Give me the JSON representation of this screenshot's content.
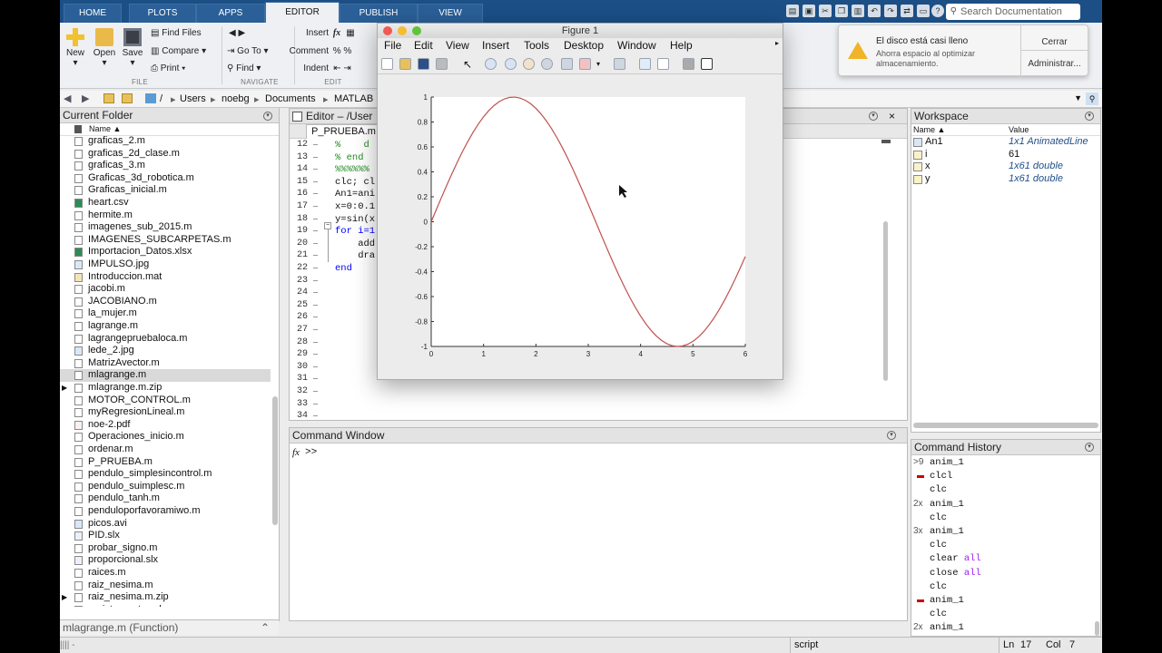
{
  "tabs": [
    "HOME",
    "PLOTS",
    "APPS",
    "EDITOR",
    "PUBLISH",
    "VIEW"
  ],
  "active_tab": "EDITOR",
  "search": {
    "placeholder": "Search Documentation"
  },
  "ribbon": {
    "new": "New",
    "open": "Open",
    "save": "Save",
    "find_files": "Find Files",
    "compare": "Compare",
    "print": "Print",
    "insert": "Insert",
    "fx": "fx",
    "comment": "Comment",
    "indent": "Indent",
    "go_to": "Go To",
    "find": "Find",
    "sec_file": "FILE",
    "sec_navigate": "NAVIGATE",
    "sec_edit": "EDIT"
  },
  "address": {
    "sep": "/",
    "parts": [
      "Users",
      "noebg",
      "Documents",
      "MATLAB"
    ]
  },
  "notification": {
    "title": "El disco está casi lleno",
    "body": "Ahorra espacio al optimizar almacenamiento.",
    "close": "Cerrar",
    "manage": "Administrar..."
  },
  "current_folder": {
    "title": "Current Folder",
    "col_name": "Name ▲",
    "files": [
      "graficas_2.m",
      "graficas_2d_clase.m",
      "graficas_3.m",
      "Graficas_3d_robotica.m",
      "Graficas_inicial.m",
      "heart.csv",
      "hermite.m",
      "imagenes_sub_2015.m",
      "IMAGENES_SUBCARPETAS.m",
      "Importacion_Datos.xlsx",
      "IMPULSO.jpg",
      "Introduccion.mat",
      "jacobi.m",
      "JACOBIANO.m",
      "la_mujer.m",
      "lagrange.m",
      "lagrangepruebaloca.m",
      "lede_2.jpg",
      "MatrizAvector.m",
      "mlagrange.m",
      "mlagrange.m.zip",
      "MOTOR_CONTROL.m",
      "myRegresionLineal.m",
      "noe-2.pdf",
      "Operaciones_inicio.m",
      "ordenar.m",
      "P_PRUEBA.m",
      "pendulo_simplesincontrol.m",
      "pendulo_suimplesc.m",
      "pendulo_tanh.m",
      "penduloporfavoramiwo.m",
      "picos.avi",
      "PID.slx",
      "probar_signo.m",
      "proporcional.slx",
      "raices.m",
      "raiz_nesima.m",
      "raiz_nesima.m.zip",
      "registro_notas.xls"
    ],
    "selected": "mlagrange.m",
    "footer": "mlagrange.m  (Function)"
  },
  "editor": {
    "title": "Editor – /User",
    "tab": "P_PRUEBA.m",
    "lines": [
      {
        "n": "12",
        "t": "%    d"
      },
      {
        "n": "13",
        "t": "% end"
      },
      {
        "n": "14",
        "t": "%%%%%%"
      },
      {
        "n": "15",
        "t": "clc; cl"
      },
      {
        "n": "16",
        "t": "An1=ani"
      },
      {
        "n": "17",
        "t": "x=0:0.1"
      },
      {
        "n": "18",
        "t": "y=sin(x"
      },
      {
        "n": "19",
        "t": "for i=1"
      },
      {
        "n": "20",
        "t": "    add"
      },
      {
        "n": "21",
        "t": "    dra"
      },
      {
        "n": "22",
        "t": "end"
      },
      {
        "n": "23",
        "t": ""
      },
      {
        "n": "24",
        "t": ""
      },
      {
        "n": "25",
        "t": ""
      },
      {
        "n": "26",
        "t": ""
      },
      {
        "n": "27",
        "t": ""
      },
      {
        "n": "28",
        "t": ""
      },
      {
        "n": "29",
        "t": ""
      },
      {
        "n": "30",
        "t": ""
      },
      {
        "n": "31",
        "t": ""
      },
      {
        "n": "32",
        "t": ""
      },
      {
        "n": "33",
        "t": ""
      },
      {
        "n": "34",
        "t": ""
      }
    ]
  },
  "command_window": {
    "title": "Command Window",
    "fx": "fx",
    "prompt": ">>"
  },
  "workspace": {
    "title": "Workspace",
    "col_name": "Name ▲",
    "col_value": "Value",
    "vars": [
      {
        "name": "An1",
        "value": "1x1 AnimatedLine"
      },
      {
        "name": "i",
        "value": "61"
      },
      {
        "name": "x",
        "value": "1x61 double"
      },
      {
        "name": "y",
        "value": "1x61 double"
      }
    ]
  },
  "history": {
    "title": "Command History",
    "items": [
      {
        "mark": ">9",
        "text": "anim_1"
      },
      {
        "mark": "red",
        "text": "clcl"
      },
      {
        "mark": "",
        "text": "clc"
      },
      {
        "mark": "2x",
        "text": "anim_1"
      },
      {
        "mark": "",
        "text": "clc"
      },
      {
        "mark": "3x",
        "text": "anim_1"
      },
      {
        "mark": "",
        "text": "clc"
      },
      {
        "mark": "",
        "text": "clear all"
      },
      {
        "mark": "",
        "text": "close all"
      },
      {
        "mark": "",
        "text": "clc"
      },
      {
        "mark": "red",
        "text": "anim_1"
      },
      {
        "mark": "",
        "text": "clc"
      },
      {
        "mark": "2x",
        "text": "anim_1"
      }
    ]
  },
  "status": {
    "mode": "script",
    "ln_label": "Ln",
    "ln": "17",
    "col_label": "Col",
    "col": "7"
  },
  "figure": {
    "title": "Figure 1",
    "menu": [
      "File",
      "Edit",
      "View",
      "Insert",
      "Tools",
      "Desktop",
      "Window",
      "Help"
    ]
  },
  "chart_data": {
    "type": "line",
    "title": "",
    "xlabel": "",
    "ylabel": "",
    "xlim": [
      0,
      6
    ],
    "ylim": [
      -1,
      1
    ],
    "xticks": [
      0,
      1,
      2,
      3,
      4,
      5,
      6
    ],
    "yticks": [
      -1,
      -0.8,
      -0.6,
      -0.4,
      -0.2,
      0,
      0.2,
      0.4,
      0.6,
      0.8,
      1
    ],
    "series": [
      {
        "function": "y = sin(x)",
        "x_start": 0,
        "x_end": 6,
        "x_step": 0.1,
        "color": "#c0504d"
      }
    ],
    "grid": false
  }
}
